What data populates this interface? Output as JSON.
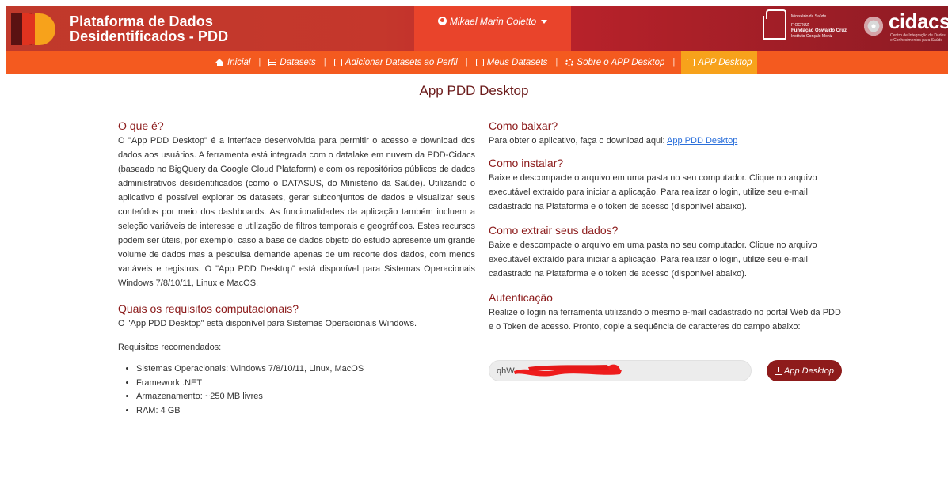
{
  "header": {
    "brand_line1": "Plataforma de Dados",
    "brand_line2": "Desidentificados - PDD",
    "user_name": "Mikael Marin Coletto",
    "fiocruz": {
      "line1": "Ministério da Saúde",
      "line2": "FIOCRUZ",
      "line3": "Fundação Oswaldo Cruz",
      "line4": "Instituto Gonçalo Moniz"
    },
    "cidacs": {
      "wordmark": "cidacs",
      "subtitle": "Centro de Integração de Dados e Conhecimentos para Saúde"
    }
  },
  "nav": {
    "items": [
      {
        "label": "Inicial",
        "icon": "home-icon"
      },
      {
        "label": "Datasets",
        "icon": "table-icon"
      },
      {
        "label": "Adicionar Datasets ao Perfil",
        "icon": "file-icon"
      },
      {
        "label": "Meus Datasets",
        "icon": "edit-icon"
      },
      {
        "label": "Sobre o APP Desktop",
        "icon": "gear-icon"
      },
      {
        "label": "APP Desktop",
        "icon": "chat-icon",
        "active": true
      }
    ],
    "separator": "|"
  },
  "page": {
    "title": "App PDD Desktop"
  },
  "left": {
    "what_title": "O que é?",
    "what_text": "O \"App PDD Desktop\" é a interface desenvolvida para permitir o acesso e download dos dados aos usuários. A ferramenta está integrada com o datalake em nuvem da PDD-Cidacs (baseado no BigQuery da Google Cloud Plataform) e com os repositórios públicos de dados administrativos desidentificados (como o DATASUS, do Ministério da Saúde). Utilizando o aplicativo é possível explorar os datasets, gerar subconjuntos de dados e visualizar seus conteúdos por meio dos dashboards. As funcionalidades da aplicação também incluem a seleção variáveis de interesse e utilização de filtros temporais e geográficos. Estes recursos podem ser úteis, por exemplo, caso a base de dados objeto do estudo apresente um grande volume de dados mas a pesquisa demande apenas de um recorte dos dados, com menos variáveis e registros. O \"App PDD Desktop\" está disponível para Sistemas Operacionais Windows 7/8/10/11, Linux e MacOS.",
    "req_title": "Quais os requisitos computacionais?",
    "req_text": "O \"App PDD Desktop\" está disponível para Sistemas Operacionais Windows.",
    "recommended_label": "Requisitos recomendados:",
    "requirements": [
      "Sistemas Operacionais: Windows 7/8/10/11, Linux, MacOS",
      "Framework .NET",
      "Armazenamento: ~250 MB livres",
      "RAM: 4 GB"
    ]
  },
  "right": {
    "download_title": "Como baixar?",
    "download_text": "Para obter o aplicativo, faça o download aqui:",
    "download_link": "App PDD Desktop",
    "install_title": "Como instalar?",
    "install_text": "Baixe e descompacte o arquivo em uma pasta no seu computador. Clique no arquivo executável extraído para iniciar a aplicação. Para realizar o login, utilize seu e-mail cadastrado na Plataforma e o token de acesso (disponível abaixo).",
    "extract_title": "Como extrair seus dados?",
    "extract_text": "Baixe e descompacte o arquivo em uma pasta no seu computador. Clique no arquivo executável extraído para iniciar a aplicação. Para realizar o login, utilize seu e-mail cadastrado na Plataforma e o token de acesso (disponível abaixo).",
    "auth_title": "Autenticação",
    "auth_text": "Realize o login na ferramenta utilizando o mesmo e-mail cadastrado no portal Web da PDD e o Token de acesso. Pronto, copie a sequência de caracteres do campo abaixo:",
    "token_value": "qhW",
    "token_button": "App Desktop"
  },
  "colors": {
    "header_red": "#c0392b",
    "header_dark": "#8e1b24",
    "nav_orange": "#f45a1f",
    "nav_active": "#f7a21b",
    "heading": "#8b1a1a",
    "button": "#8e1b1b",
    "link": "#2a6fdb"
  }
}
